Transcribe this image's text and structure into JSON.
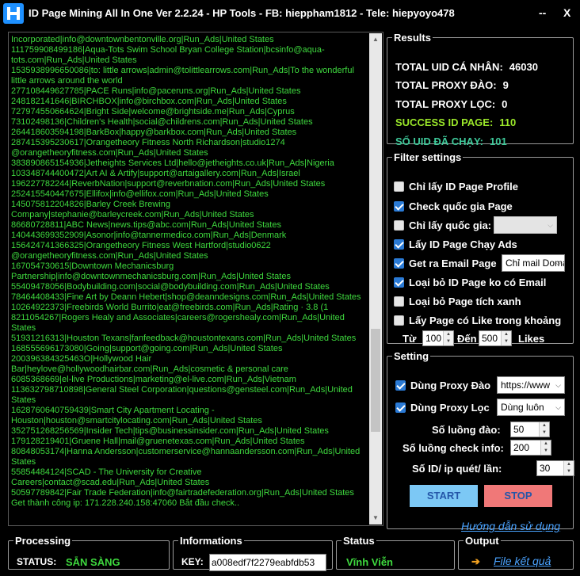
{
  "window": {
    "title": "ID Page Mining All In One Ver 2.2.24 - HP Tools - FB: hieppham1812 - Tele: hiepyoyo478",
    "minimize": "--",
    "close": "X"
  },
  "log": {
    "lines": [
      "Incorporated|info@downtownbentonville.org|Run_Ads|United States",
      "111759908499186|Aqua-Tots Swim School Bryan College Station|bcsinfo@aqua-tots.com|Run_Ads|United States",
      "1535938996650086|to: little arrows|admin@tolittlearrows.com|Run_Ads|To the wonderful little arrows around the world",
      "277108449627785|PACE Runs|info@paceruns.org|Run_Ads|United States",
      "248182141646|BIRCHBOX|info@birchbox.com|Run_Ads|United States",
      "727974550664624|Bright Side|welcome@brightside.me|Run_Ads|Cyprus",
      "73102498136|Children's Health|social@childrens.com|Run_Ads|United States",
      "264418603594198|BarkBox|happy@barkbox.com|Run_Ads|United States",
      "287415395230617|Orangetheory Fitness North Richardson|studio1274 @orangetheoryfitness.com|Run_Ads|United States",
      "383890865154936|Jetheights Services Ltd|hello@jetheights.co.uk|Run_Ads|Nigeria",
      "103348744400472|Art AI & Artify|support@artaigallery.com|Run_Ads|Israel",
      "196227782244|ReverbNation|support@reverbnation.com|Run_Ads|United States",
      "252415540447675|Ellifox|info@ellifox.com|Run_Ads|United States",
      "145075812204826|Barley Creek Brewing Company|stephanie@barleycreek.com|Run_Ads|United States",
      "86680728811|ABC News|news.tips@abc.com|Run_Ads|United States",
      "140443699352909|Asonor|info@tannermedico.com|Run_Ads|Denmark",
      "156424741366325|Orangetheory Fitness West Hartford|studio0622 @orangetheoryfitness.com|Run_Ads|United States",
      "167054730615|Downtown Mechanicsburg Partnership|info@downtownmechanicsburg.com|Run_Ads|United States",
      "55409478056|Bodybuilding.com|social@bodybuilding.com|Run_Ads|United States",
      "78464408433|Fine Art by Deann Hebert|shop@deanndesigns.com|Run_Ads|United States",
      "10264922373|Freebirds World Burrito|eat@freebirds.com|Run_Ads|Rating · 3.8 (1",
      "8211054267|Rogers Healy and Associates|careers@rogershealy.com|Run_Ads|United States",
      "51931216313|Houston Texans|fanfeedback@houstontexans.com|Run_Ads|United States",
      "168555696173080|Going|support@going.com|Run_Ads|United States",
      "200396384325463O|Hollywood Hair Bar|heylove@hollywoodhairbar.com|Run_Ads|cosmetic & personal care",
      "6085368669|el-live Productions|marketing@el-live.com|Run_Ads|Vietnam",
      "113632798710898|General Steel Corporation|questions@gensteel.com|Run_Ads|United States",
      "1628760640759439|Smart City Apartment Locating - Houston|houston@smartcitylocating.com|Run_Ads|United States",
      "352751268256569|Insider Tech|tips@businessinsider.com|Run_Ads|United States",
      "179128219401|Gruene Hall|mail@gruenetexas.com|Run_Ads|United States",
      "80848053174|Hanna Andersson|customerservice@hannaandersson.com|Run_Ads|United States",
      "55854484124|SCAD - The University for Creative Careers|contact@scad.edu|Run_Ads|United States",
      "50597789842|Fair Trade Federation|info@fairtradefederation.org|Run_Ads|United States",
      "Get thành công ip: 171.228.240.158:47060 Bắt đầu check.."
    ],
    "scroll_position": 0.78
  },
  "results": {
    "legend": "Results",
    "rows": [
      {
        "label": "TOTAL UID CÁ NHÂN:",
        "value": "46030",
        "color": "#ffffff"
      },
      {
        "label": "TOTAL PROXY ĐÀO:",
        "value": "9",
        "color": "#ffffff"
      },
      {
        "label": "TOTAL PROXY LỌC:",
        "value": "0",
        "color": "#ffffff"
      },
      {
        "label": "SUCCESS ID PAGE:",
        "value": "110",
        "color": "#9be82a"
      },
      {
        "label": "SỐ UID ĐÃ CHẠY:",
        "value": "101",
        "color": "#3ec99a"
      }
    ]
  },
  "filter": {
    "legend": "Filter settings",
    "options": [
      {
        "label": "Chỉ lấy ID Page Profile",
        "checked": false
      },
      {
        "label": "Check quốc gia Page",
        "checked": true
      },
      {
        "label": "Chỉ lấy quốc gia:",
        "checked": false
      },
      {
        "label": "Lấy ID Page Chạy Ads",
        "checked": true
      },
      {
        "label": "Get ra Email Page",
        "checked": true
      },
      {
        "label": "Loại bỏ ID Page ko có Email",
        "checked": true
      },
      {
        "label": "Loại bỏ Page tích xanh",
        "checked": false
      },
      {
        "label": "Lấy Page có Like trong khoảng",
        "checked": false
      }
    ],
    "country_select": "",
    "email_select": "Chỉ mail Doma",
    "like_from_label": "Từ",
    "like_from": "100",
    "like_to_label": "Đến",
    "like_to": "500",
    "likes_label": "Likes"
  },
  "setting": {
    "legend": "Setting",
    "proxy_dao": {
      "label": "Dùng Proxy Đào",
      "checked": true,
      "select": "https://www"
    },
    "proxy_loc": {
      "label": "Dùng Proxy Lọc",
      "checked": true,
      "select": "Dùng luôn"
    },
    "threads_dao_label": "Số luồng đào:",
    "threads_dao": "50",
    "threads_check_label": "Số luồng check info:",
    "threads_check": "200",
    "ids_per_ip_label": "Số ID/ ip quét/ lần:",
    "ids_per_ip": "30",
    "start": "START",
    "stop": "STOP",
    "guide": "Hướng dẫn sử dụng"
  },
  "bottom": {
    "processing": {
      "legend": "Processing",
      "label": "STATUS:",
      "value": "SẴN SÀNG"
    },
    "informations": {
      "legend": "Informations",
      "label": "KEY:",
      "value": "a008edf7f2279eabfdb53"
    },
    "status": {
      "legend": "Status",
      "value": "Vĩnh Viễn"
    },
    "output": {
      "legend": "Output",
      "link": "File kết quả"
    }
  },
  "colors": {
    "accent_green": "#3ed93e",
    "start_bg": "#7cc8f5",
    "stop_bg": "#f07878",
    "link": "#4aa3ff",
    "checkbox": "#2a7ad5",
    "arrow_orange": "#f0a020"
  }
}
